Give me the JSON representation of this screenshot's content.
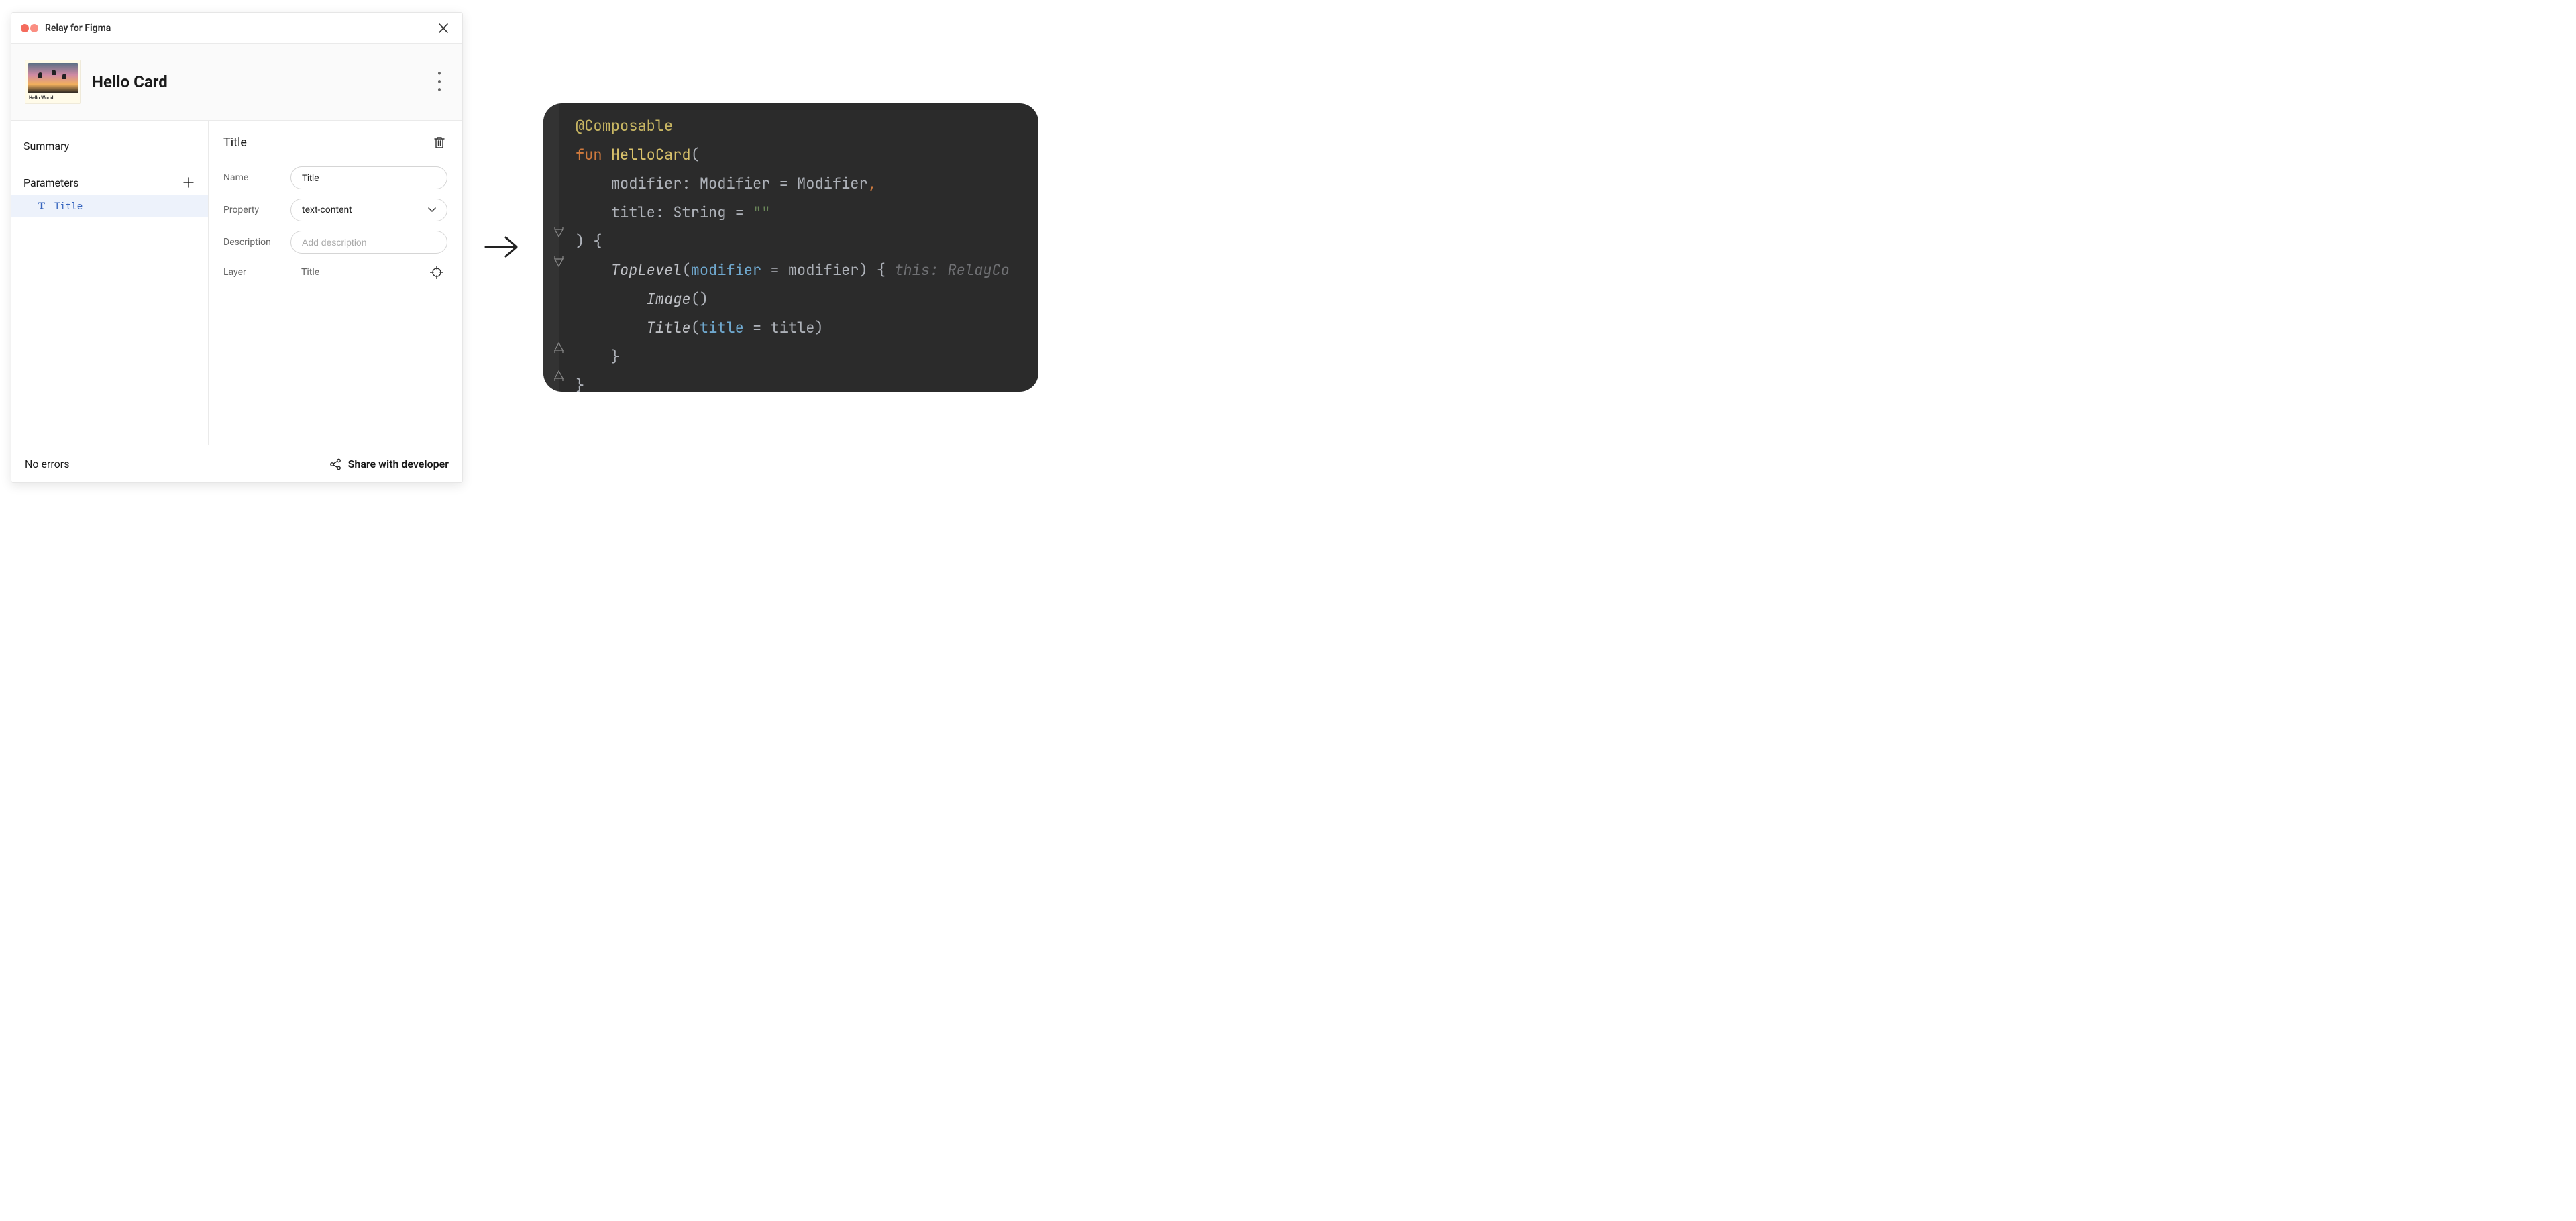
{
  "panel": {
    "title": "Relay for Figma",
    "component_name": "Hello Card",
    "thumbnail_caption": "Hello World",
    "sidebar": {
      "summary_label": "Summary",
      "parameters_label": "Parameters",
      "parameters": [
        {
          "type_glyph": "T",
          "name": "Title"
        }
      ]
    },
    "detail": {
      "title": "Title",
      "rows": {
        "name_label": "Name",
        "name_value": "Title",
        "property_label": "Property",
        "property_value": "text-content",
        "description_label": "Description",
        "description_placeholder": "Add description",
        "layer_label": "Layer",
        "layer_value": "Title"
      }
    },
    "footer": {
      "errors": "No errors",
      "share_label": "Share with developer"
    }
  },
  "code": {
    "tokens": {
      "annot": "@Composable",
      "fun": "fun",
      "fn_name": "HelloCard",
      "lparen": "(",
      "mod_name": "modifier",
      "colon_sp": ": ",
      "mod_type": "Modifier",
      "eq_sp": " = ",
      "mod_default": "Modifier",
      "comma": ",",
      "title_name": "title",
      "string_type": "String",
      "empty_str": "\"\"",
      "rparen_brace": ") {",
      "top_level": "TopLevel",
      "modifier_param": "modifier",
      "eq": " = ",
      "modifier_arg": "modifier",
      "rparen_sp_brace": ") {",
      "hint": "this: RelayCo",
      "image_call": "Image",
      "parens": "()",
      "title_call": "Title",
      "title_param": "title",
      "title_arg": "title",
      "rparen": ")",
      "rbrace": "}"
    }
  }
}
